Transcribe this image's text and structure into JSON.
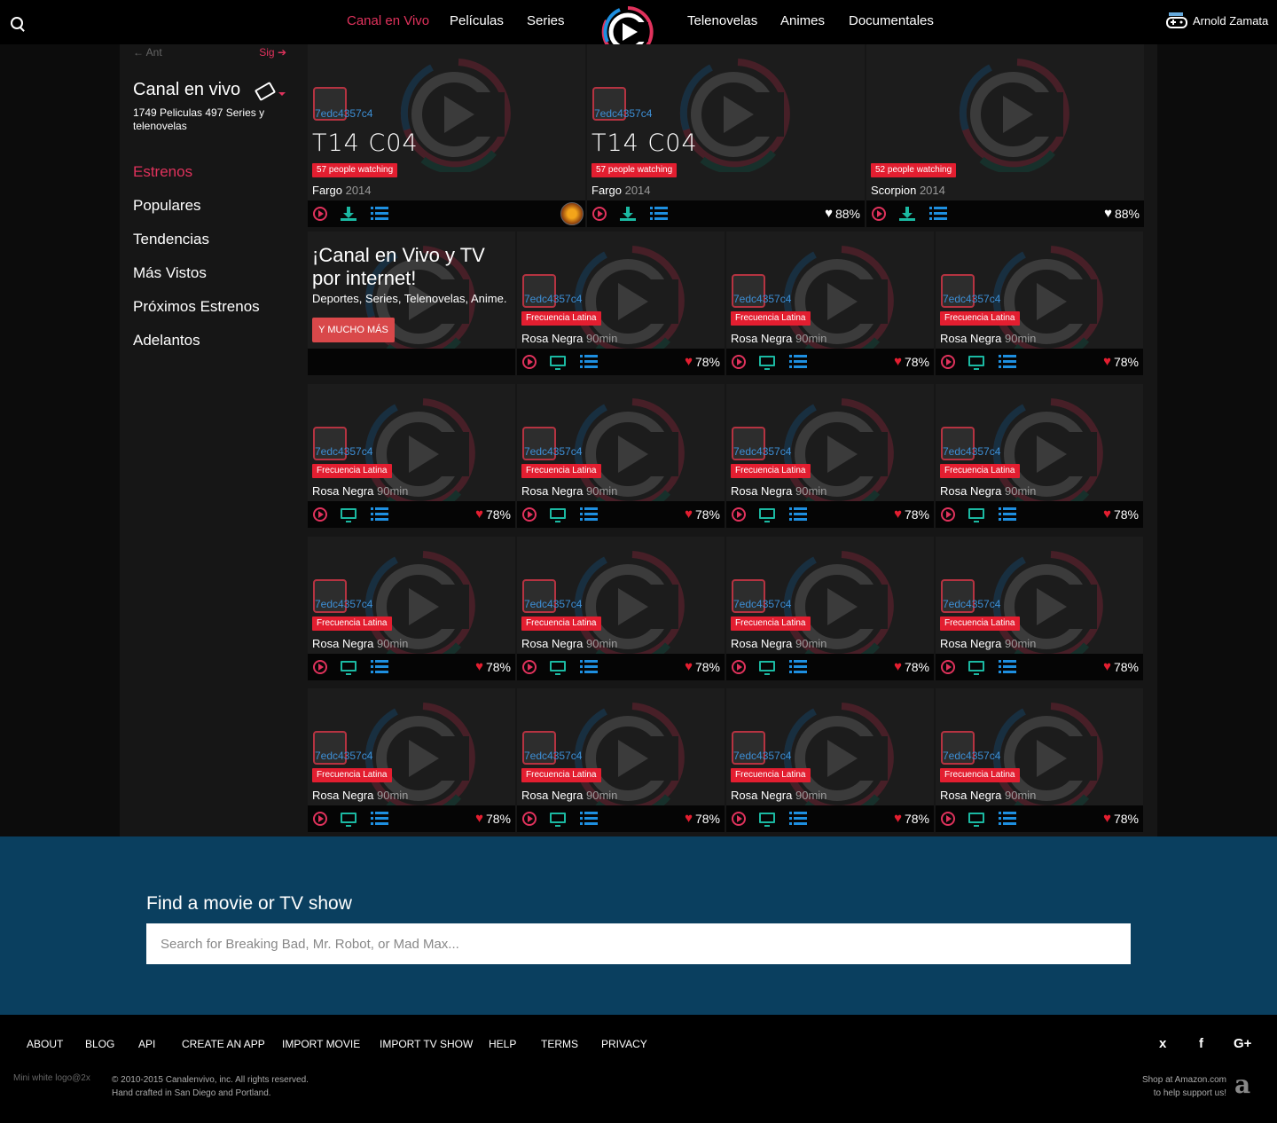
{
  "nav": {
    "links": [
      {
        "label": "Canal en Vivo",
        "active": true
      },
      {
        "label": "Películas"
      },
      {
        "label": "Series"
      },
      {
        "label": "Telenovelas"
      },
      {
        "label": "Animes"
      },
      {
        "label": "Documentales"
      }
    ],
    "user": {
      "name": "Arnold Zamata"
    }
  },
  "sidebar": {
    "prev": "Ant",
    "next": "Sig",
    "title": "Canal en vivo",
    "counts": "1749 Peliculas 497 Series y telenovelas",
    "menu": [
      {
        "label": "Estrenos",
        "active": true
      },
      {
        "label": "Populares"
      },
      {
        "label": "Tendencias"
      },
      {
        "label": "Más Vistos"
      },
      {
        "label": "Próximos Estrenos"
      },
      {
        "label": "Adelantos"
      }
    ]
  },
  "featured": [
    {
      "episode": "T14  C04",
      "badge": "57 people watching",
      "title": "Fargo",
      "year": "2014",
      "poster_alt": "7edc4357c4",
      "rating": ""
    },
    {
      "episode": "T14  C04",
      "badge": "57 people watching",
      "title": "Fargo",
      "year": "2014",
      "poster_alt": "7edc4357c4",
      "rating": "88%"
    },
    {
      "episode": "",
      "badge": "52 people watching",
      "title": "Scorpion",
      "year": "2014",
      "poster_alt": "",
      "rating": "88%"
    }
  ],
  "promo": {
    "title": "¡Canal en Vivo y TV por internet!",
    "subtitle": "Deportes, Series, Telenovelas, Anime.",
    "button": "Y MUCHO MÁS"
  },
  "channel_card": {
    "poster_alt": "7edc4357c4",
    "badge": "Frecuencia Latina",
    "title": "Rosa Negra",
    "duration": "90min",
    "rating": "78%"
  },
  "search": {
    "heading": "Find a movie or TV show",
    "placeholder": "Search for Breaking Bad, Mr. Robot, or Mad Max..."
  },
  "footer": {
    "links": [
      "ABOUT",
      "BLOG",
      "API",
      "CREATE AN APP",
      "IMPORT MOVIE",
      "IMPORT TV SHOW",
      "HELP",
      "TERMS",
      "PRIVACY"
    ],
    "mini_logo_alt": "Mini white logo@2x",
    "copyright_1": "© 2010-2015 Canalenvivo, inc. All rights reserved.",
    "copyright_2": "Hand crafted in San Diego and Portland.",
    "amazon_1": "Shop at Amazon.com",
    "amazon_2": "to help support us!",
    "social": [
      "twitter-icon",
      "facebook-icon",
      "google-plus-icon"
    ]
  },
  "colors": {
    "accent": "#e0325c",
    "badge": "#e31e30",
    "teal": "#1bb9a2",
    "blue": "#1e8fe0",
    "search_bg": "#0a3f5f"
  }
}
